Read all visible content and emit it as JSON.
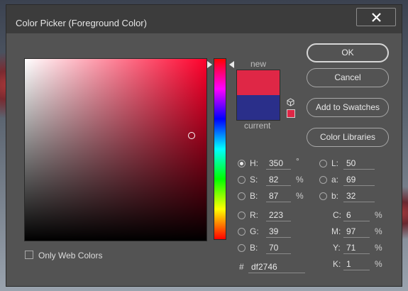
{
  "dialog": {
    "title": "Color Picker (Foreground Color)",
    "close_label": "X"
  },
  "preview": {
    "new_label": "new",
    "current_label": "current",
    "new_color": "#df2746",
    "current_color": "#2a2f8a"
  },
  "buttons": {
    "ok": "OK",
    "cancel": "Cancel",
    "add_to_swatches": "Add to Swatches",
    "color_libraries": "Color Libraries"
  },
  "hsb": {
    "h_label": "H:",
    "h_value": "350",
    "h_unit": "°",
    "s_label": "S:",
    "s_value": "82",
    "s_unit": "%",
    "b_label": "B:",
    "b_value": "87",
    "b_unit": "%"
  },
  "rgb": {
    "r_label": "R:",
    "r_value": "223",
    "g_label": "G:",
    "g_value": "39",
    "b_label": "B:",
    "b_value": "70"
  },
  "lab": {
    "l_label": "L:",
    "l_value": "50",
    "a_label": "a:",
    "a_value": "69",
    "b_label": "b:",
    "b_value": "32"
  },
  "cmyk": {
    "c_label": "C:",
    "c_value": "6",
    "c_unit": "%",
    "m_label": "M:",
    "m_value": "97",
    "m_unit": "%",
    "y_label": "Y:",
    "y_value": "71",
    "y_unit": "%",
    "k_label": "K:",
    "k_value": "1",
    "k_unit": "%"
  },
  "hex": {
    "label": "#",
    "value": "df2746"
  },
  "only_web_colors": "Only Web Colors"
}
